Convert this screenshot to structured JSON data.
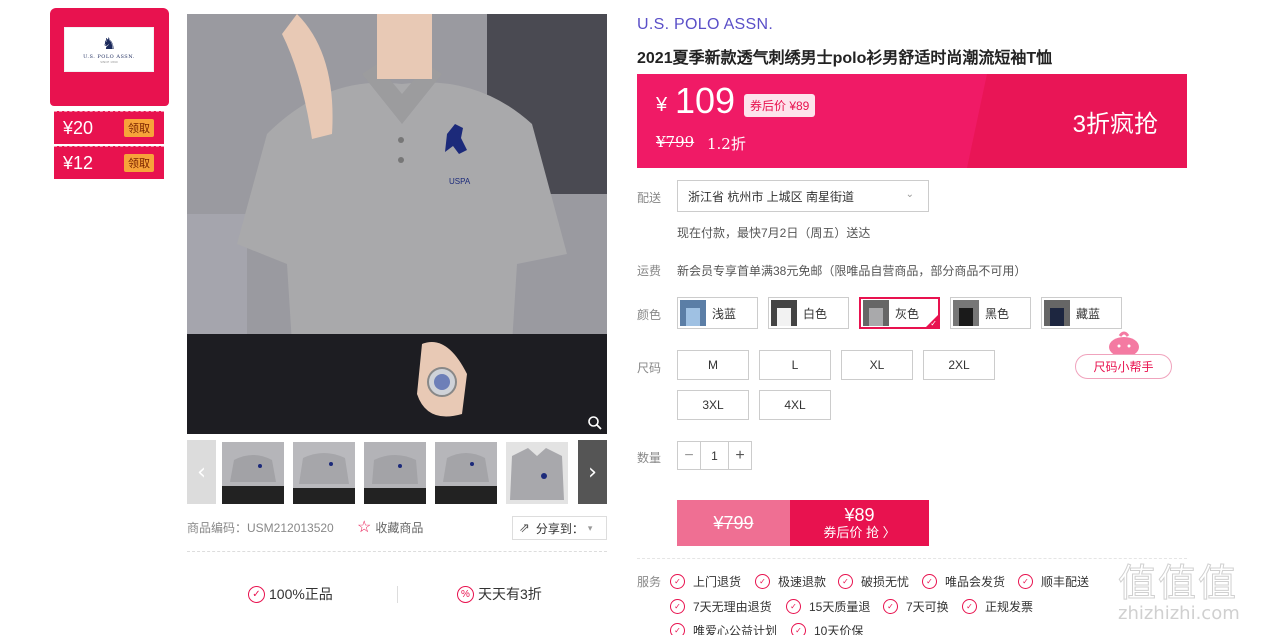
{
  "coupons": {
    "brand_logo_text": "U.S. POLO ASSN.",
    "brand_logo_sub": "SINCE 1890",
    "items": [
      {
        "amount": "¥20",
        "claim": "领取"
      },
      {
        "amount": "¥12",
        "claim": "领取"
      }
    ]
  },
  "gallery": {
    "prev": "‹",
    "next": "›",
    "shirt_print": "USPA",
    "sku_code": "商品编码：USM212013520",
    "favorite": "收藏商品",
    "share": "分享到："
  },
  "assurance": {
    "genuine": "100%正品",
    "daily_discount": "天天有3折"
  },
  "product": {
    "brand": "U.S. POLO ASSN.",
    "title": "2021夏季新款透气刺绣男士polo衫男舒适时尚潮流短袖T恤"
  },
  "price": {
    "currency": "¥",
    "current": "109",
    "after_coupon": "券后价 ¥89",
    "original": "¥799",
    "discount": "1.2折",
    "promo": "3折疯抢"
  },
  "delivery": {
    "label": "配送",
    "address": "浙江省 杭州市 上城区 南星街道",
    "note": "现在付款，最快7月2日（周五）送达"
  },
  "shipping": {
    "label": "运费",
    "note": "新会员专享首单满38元免邮（限唯品自营商品，部分商品不可用）"
  },
  "colors": {
    "label": "颜色",
    "options": [
      "浅蓝",
      "白色",
      "灰色",
      "黑色",
      "藏蓝"
    ],
    "selected": "灰色"
  },
  "sizes": {
    "label": "尺码",
    "options": [
      "M",
      "L",
      "XL",
      "2XL",
      "3XL",
      "4XL"
    ],
    "helper": "尺码小帮手"
  },
  "quantity": {
    "label": "数量",
    "value": "1",
    "minus": "−",
    "plus": "+"
  },
  "buy": {
    "original": "¥799",
    "price": "¥89",
    "action": "券后价 抢 〉"
  },
  "services": {
    "label": "服务",
    "items": [
      "上门退货",
      "极速退款",
      "破损无忧",
      "唯品会发货",
      "顺丰配送",
      "7天无理由退货",
      "15天质量退",
      "7天可换",
      "正规发票",
      "唯爱心公益计划",
      "10天价保"
    ]
  },
  "watermark": {
    "zh": "值值值",
    "en": "zhizhizhi.com"
  },
  "colors_theme": {
    "accent": "#e8124f",
    "price_bg": "#f01a66",
    "brand": "#5a4fc8",
    "claim_badge": "#f7a33a"
  }
}
